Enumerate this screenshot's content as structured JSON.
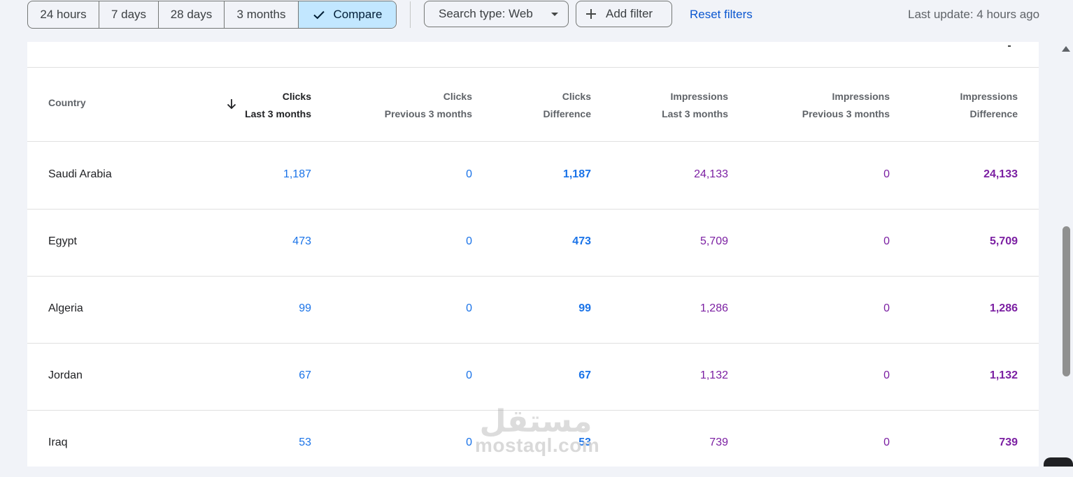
{
  "toolbar": {
    "ranges": [
      "24 hours",
      "7 days",
      "28 days",
      "3 months"
    ],
    "compare_label": "Compare",
    "search_type_label": "Search type: Web",
    "add_filter_label": "Add filter",
    "reset_filters_label": "Reset filters",
    "last_update": "Last update: 4 hours ago"
  },
  "table": {
    "country_header": "Country",
    "columns": [
      {
        "line1": "Clicks",
        "line2": "Last 3 months"
      },
      {
        "line1": "Clicks",
        "line2": "Previous 3 months"
      },
      {
        "line1": "Clicks",
        "line2": "Difference"
      },
      {
        "line1": "Impressions",
        "line2": "Last 3 months"
      },
      {
        "line1": "Impressions",
        "line2": "Previous 3 months"
      },
      {
        "line1": "Impressions",
        "line2": "Difference"
      }
    ],
    "rows": [
      {
        "country": "Saudi Arabia",
        "clicks_last": "1,187",
        "clicks_prev": "0",
        "clicks_diff": "1,187",
        "impr_last": "24,133",
        "impr_prev": "0",
        "impr_diff": "24,133"
      },
      {
        "country": "Egypt",
        "clicks_last": "473",
        "clicks_prev": "0",
        "clicks_diff": "473",
        "impr_last": "5,709",
        "impr_prev": "0",
        "impr_diff": "5,709"
      },
      {
        "country": "Algeria",
        "clicks_last": "99",
        "clicks_prev": "0",
        "clicks_diff": "99",
        "impr_last": "1,286",
        "impr_prev": "0",
        "impr_diff": "1,286"
      },
      {
        "country": "Jordan",
        "clicks_last": "67",
        "clicks_prev": "0",
        "clicks_diff": "67",
        "impr_last": "1,132",
        "impr_prev": "0",
        "impr_diff": "1,132"
      },
      {
        "country": "Iraq",
        "clicks_last": "53",
        "clicks_prev": "0",
        "clicks_diff": "53",
        "impr_last": "739",
        "impr_prev": "0",
        "impr_diff": "739"
      }
    ]
  },
  "colors": {
    "clicks": "#1a73e8",
    "impressions": "#7b1fa2",
    "active_segment": "#c2e7ff",
    "link": "#0b57d0"
  },
  "icons": {
    "compare_check": "check-icon",
    "search_type_caret": "caret-down-icon",
    "add_filter": "plus-icon",
    "sort": "arrow-down-icon"
  },
  "watermark": {
    "logo_text": "مستقل",
    "text": "mostaql.com"
  }
}
